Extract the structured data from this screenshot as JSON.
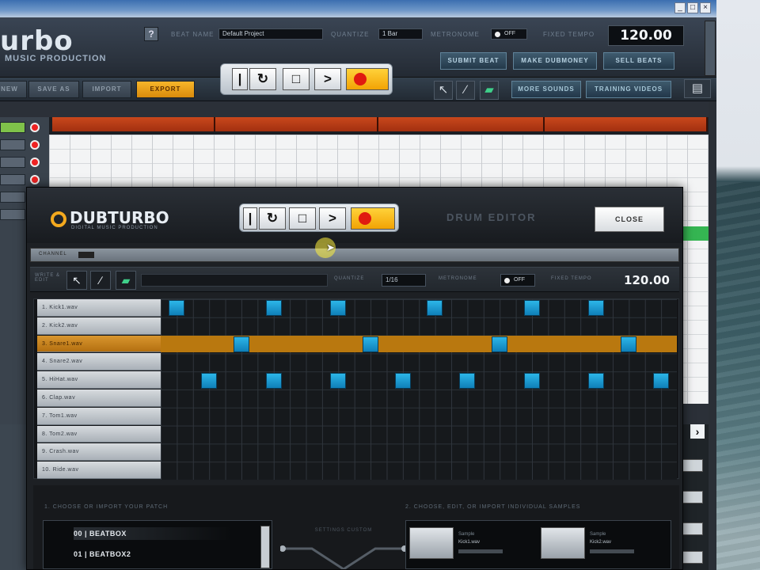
{
  "app": {
    "logo": "urbo",
    "logo_sub": "MUSIC PRODUCTION",
    "help_label": "?",
    "beat_name_label": "BEAT NAME",
    "beat_name_value": "Default Project",
    "quantize_label": "QUANTIZE",
    "quantize_value": "1 Bar",
    "metronome_label": "METRONOME",
    "metronome_value": "OFF",
    "fixed_tempo_label": "FIXED TEMPO",
    "tempo": "120.00",
    "buttons": {
      "submit": "SUBMIT BEAT",
      "make_money": "MAKE DUBMONEY",
      "sell": "SELL BEATS"
    }
  },
  "toolbar": {
    "tabs": [
      "NEW",
      "SAVE AS",
      "IMPORT",
      "EXPORT"
    ],
    "more_sounds": "MORE SOUNDS",
    "training": "TRAINING VIDEOS"
  },
  "editor": {
    "logo": "DUBTURBO",
    "logo_sub": "DIGITAL MUSIC PRODUCTION",
    "title": "DRUM EDITOR",
    "close": "CLOSE",
    "channel_label": "CHANNEL",
    "write_label": "WRITE & EDIT",
    "quantize_label": "QUANTIZE",
    "quantize_value": "1/16",
    "metronome_label": "METRONOME",
    "metronome_value": "OFF",
    "fixed_tempo_label": "FIXED TEMPO",
    "tempo": "120.00",
    "instruments": [
      "1. Kick1.wav",
      "2. Kick2.wav",
      "3. Snare1.wav",
      "4. Snare2.wav",
      "5. HiHat.wav",
      "6. Clap.wav",
      "7. Tom1.wav",
      "8. Tom2.wav",
      "9. Crash.wav",
      "10. Ride.wav"
    ],
    "selected_row": 2,
    "steps": 32,
    "pattern": [
      [
        0,
        6,
        10,
        16,
        22,
        26
      ],
      [],
      [
        4,
        12,
        20,
        28
      ],
      [],
      [
        2,
        6,
        10,
        14,
        18,
        22,
        26,
        30
      ],
      [],
      [],
      [],
      [],
      []
    ],
    "choose_patch_label": "1. CHOOSE OR IMPORT YOUR PATCH",
    "patches": [
      "00 | BEATBOX",
      "01 | BEATBOX2"
    ],
    "mid_label": "SETTINGS CUSTOM",
    "choose_samples_label": "2. CHOOSE, EDIT, OR IMPORT INDIVIDUAL SAMPLES",
    "samples": [
      {
        "label": "Sample",
        "name": "Kick1.wav"
      },
      {
        "label": "Sample",
        "name": "Kick2.wav"
      }
    ]
  },
  "window": {
    "min": "_",
    "max": "□",
    "close": "×"
  }
}
